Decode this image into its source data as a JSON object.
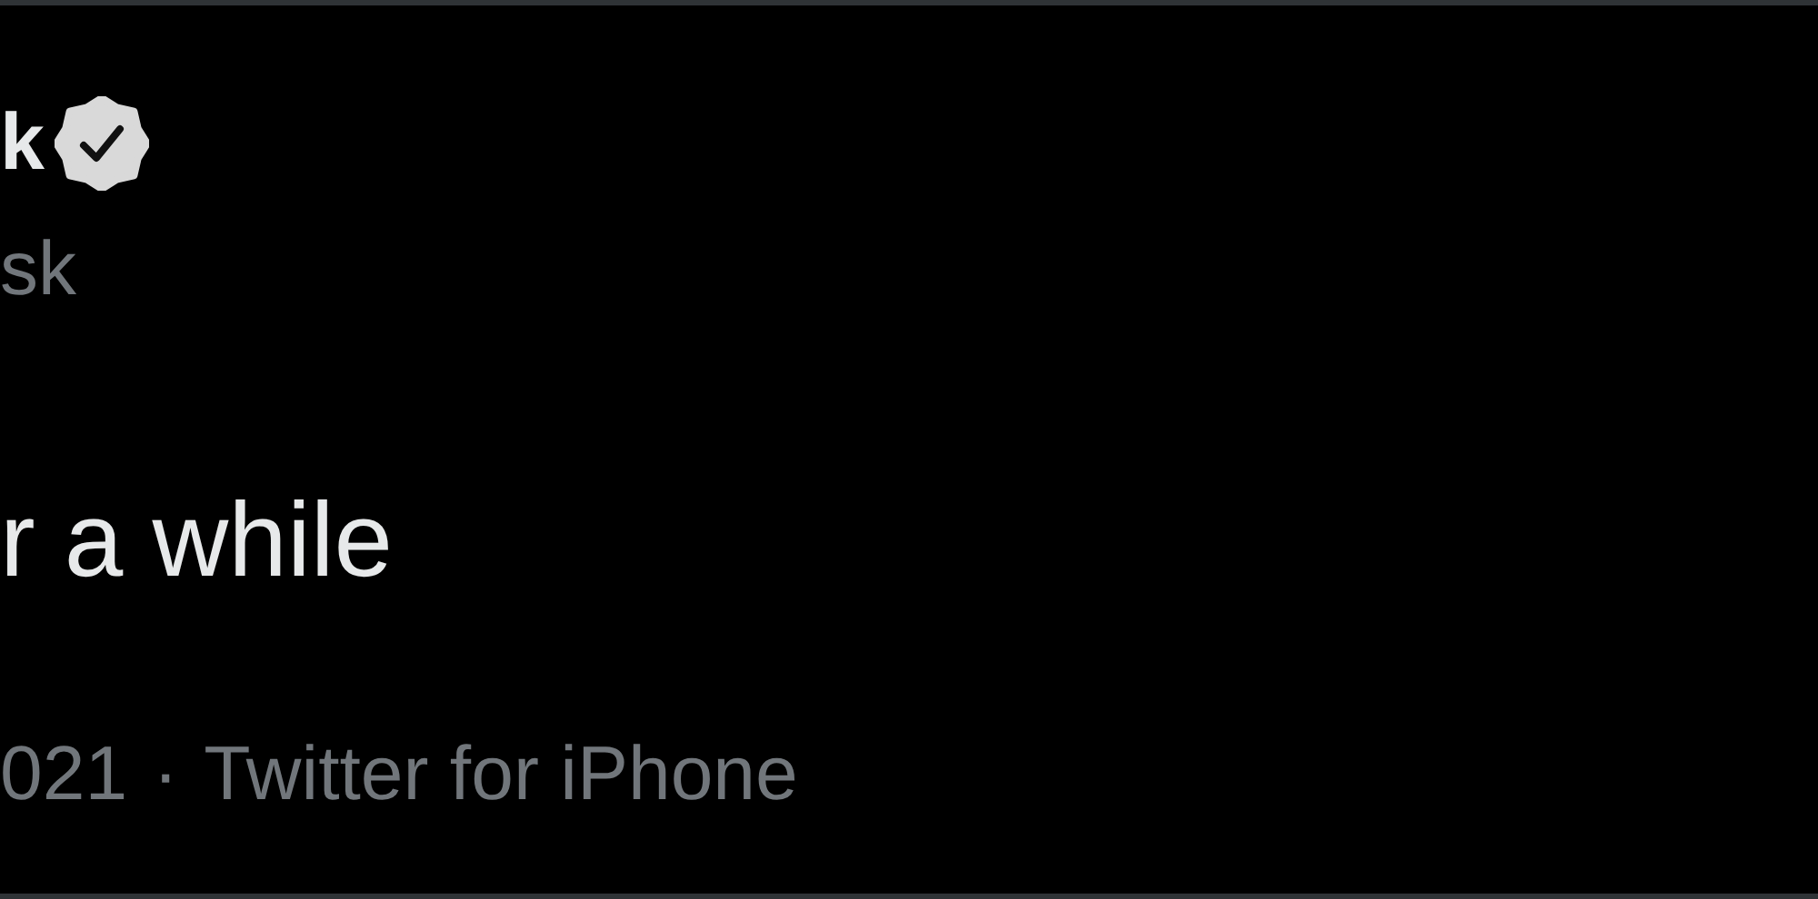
{
  "author": {
    "name": "k",
    "verified": true,
    "handle": "sk"
  },
  "tweet": {
    "text": "r a while"
  },
  "meta": {
    "date": "021",
    "separator": "·",
    "source": "Twitter for iPhone"
  }
}
